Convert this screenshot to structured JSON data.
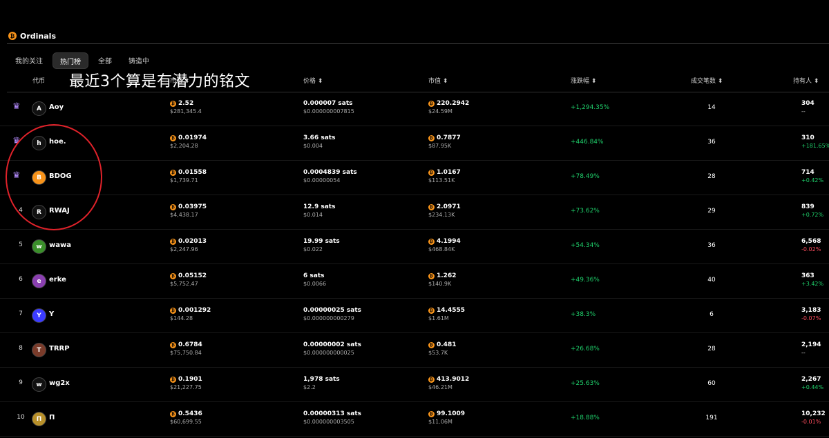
{
  "header": {
    "title": "Ordinals",
    "logo_icon": "bitcoin-icon"
  },
  "tabs": [
    {
      "label": "我的关注",
      "active": false
    },
    {
      "label": "热门榜",
      "active": true
    },
    {
      "label": "全部",
      "active": false
    },
    {
      "label": "铸造中",
      "active": false
    }
  ],
  "overlay": {
    "text": "最近3个算是有潜力的铭文"
  },
  "columns": {
    "token": "代币",
    "cap": "市值",
    "price": "价格",
    "market_cap": "市值",
    "change": "涨跌幅",
    "trades": "成交笔数",
    "holders": "持有人"
  },
  "colors": {
    "positive": "#1fd06b",
    "negative": "#ff4d5e",
    "bitcoin": "#f7931a",
    "annotation": "#e0222a"
  },
  "rows": [
    {
      "rank": "",
      "crown": true,
      "icon": "A",
      "name": "Aoy",
      "cap_btc": "2.52",
      "cap_usd": "$281,345.4",
      "price": "0.000007 sats",
      "price_usd": "$0.000000007815",
      "mcap_btc": "220.2942",
      "mcap_usd": "$24.59M",
      "change": "+1,294.35%",
      "trades": "14",
      "holders": "304",
      "holders_change": "--",
      "holders_dir": "neutral"
    },
    {
      "rank": "",
      "crown": true,
      "icon": "h",
      "name": "hoe.",
      "cap_btc": "0.01974",
      "cap_usd": "$2,204.28",
      "price": "3.66 sats",
      "price_usd": "$0.004",
      "mcap_btc": "0.7877",
      "mcap_usd": "$87.95K",
      "change": "+446.84%",
      "trades": "36",
      "holders": "310",
      "holders_change": "+181.65%",
      "holders_dir": "pos"
    },
    {
      "rank": "",
      "crown": true,
      "icon": "B",
      "name": "BDOG",
      "cap_btc": "0.01558",
      "cap_usd": "$1,739.71",
      "price": "0.0004839 sats",
      "price_usd": "$0.00000054",
      "mcap_btc": "1.0167",
      "mcap_usd": "$113.51K",
      "change": "+78.49%",
      "trades": "28",
      "holders": "714",
      "holders_change": "+0.42%",
      "holders_dir": "pos"
    },
    {
      "rank": "4",
      "crown": false,
      "icon": "R",
      "name": "RWAJ",
      "cap_btc": "0.03975",
      "cap_usd": "$4,438.17",
      "price": "12.9 sats",
      "price_usd": "$0.014",
      "mcap_btc": "2.0971",
      "mcap_usd": "$234.13K",
      "change": "+73.62%",
      "trades": "29",
      "holders": "839",
      "holders_change": "+0.72%",
      "holders_dir": "pos"
    },
    {
      "rank": "5",
      "crown": false,
      "icon": "w",
      "name": "wawa",
      "cap_btc": "0.02013",
      "cap_usd": "$2,247.96",
      "price": "19.99 sats",
      "price_usd": "$0.022",
      "mcap_btc": "4.1994",
      "mcap_usd": "$468.84K",
      "change": "+54.34%",
      "trades": "36",
      "holders": "6,568",
      "holders_change": "-0.02%",
      "holders_dir": "neg"
    },
    {
      "rank": "6",
      "crown": false,
      "icon": "e",
      "name": "erke",
      "cap_btc": "0.05152",
      "cap_usd": "$5,752.47",
      "price": "6 sats",
      "price_usd": "$0.0066",
      "mcap_btc": "1.262",
      "mcap_usd": "$140.9K",
      "change": "+49.36%",
      "trades": "40",
      "holders": "363",
      "holders_change": "+3.42%",
      "holders_dir": "pos"
    },
    {
      "rank": "7",
      "crown": false,
      "icon": "Y",
      "name": "Υ",
      "cap_btc": "0.001292",
      "cap_usd": "$144.28",
      "price": "0.00000025 sats",
      "price_usd": "$0.000000000279",
      "mcap_btc": "14.4555",
      "mcap_usd": "$1.61M",
      "change": "+38.3%",
      "trades": "6",
      "holders": "3,183",
      "holders_change": "-0.07%",
      "holders_dir": "neg"
    },
    {
      "rank": "8",
      "crown": false,
      "icon": "T",
      "name": "TRRP",
      "cap_btc": "0.6784",
      "cap_usd": "$75,750.84",
      "price": "0.00000002 sats",
      "price_usd": "$0.000000000025",
      "mcap_btc": "0.481",
      "mcap_usd": "$53.7K",
      "change": "+26.68%",
      "trades": "28",
      "holders": "2,194",
      "holders_change": "--",
      "holders_dir": "neutral"
    },
    {
      "rank": "9",
      "crown": false,
      "icon": "w",
      "name": "wg2x",
      "cap_btc": "0.1901",
      "cap_usd": "$21,227.75",
      "price": "1,978 sats",
      "price_usd": "$2.2",
      "mcap_btc": "413.9012",
      "mcap_usd": "$46.21M",
      "change": "+25.63%",
      "trades": "60",
      "holders": "2,267",
      "holders_change": "+0.44%",
      "holders_dir": "pos"
    },
    {
      "rank": "10",
      "crown": false,
      "icon": "Π",
      "name": "Π",
      "cap_btc": "0.5436",
      "cap_usd": "$60,699.55",
      "price": "0.00000313 sats",
      "price_usd": "$0.000000003505",
      "mcap_btc": "99.1009",
      "mcap_usd": "$11.06M",
      "change": "+18.88%",
      "trades": "191",
      "holders": "10,232",
      "holders_change": "-0.01%",
      "holders_dir": "neg"
    }
  ]
}
